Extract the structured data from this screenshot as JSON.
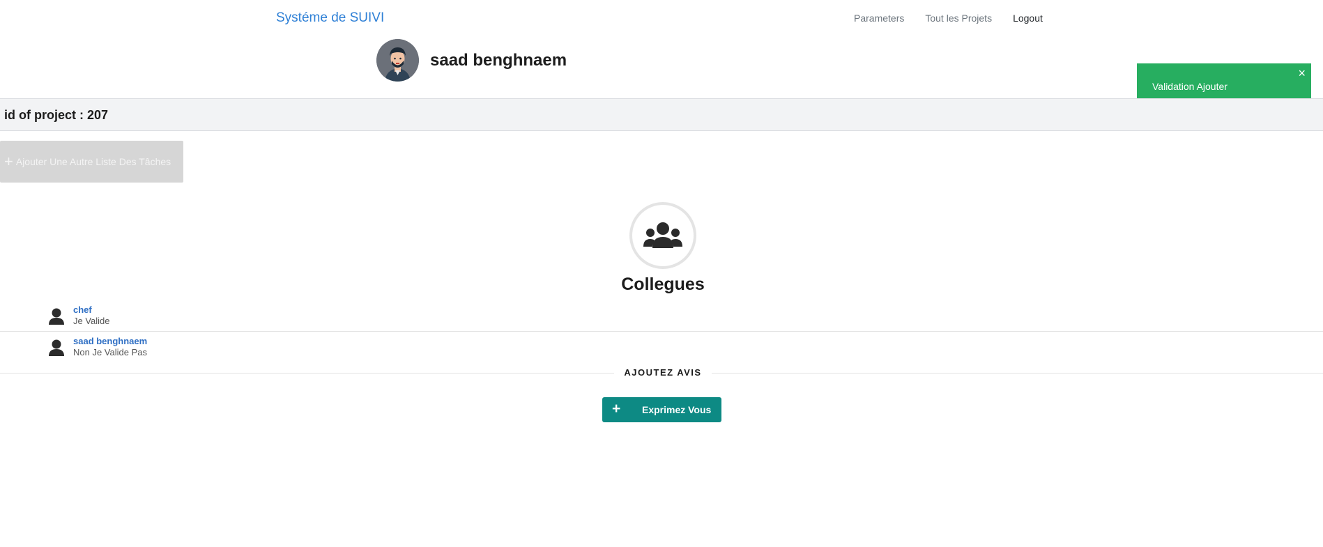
{
  "navbar": {
    "brand": "Systéme de SUIVI",
    "links": [
      "Parameters",
      "Tout les Projets",
      "Logout"
    ]
  },
  "profile": {
    "name": "saad benghnaem",
    "avatar_icon": "user-avatar-illustration"
  },
  "toast": {
    "message": "Validation Ajouter",
    "close": "×",
    "color": "#27ae60"
  },
  "project": {
    "label": "id of project : 207"
  },
  "add_list_button": {
    "icon": "plus-icon",
    "label": "Ajouter Une Autre Liste Des Tâches"
  },
  "team": {
    "icon": "users-group-icon",
    "title": "Collegues",
    "members": [
      {
        "name": "chef",
        "status": "Je Valide"
      },
      {
        "name": "saad benghnaem",
        "status": "Non Je Valide Pas"
      }
    ]
  },
  "feedback": {
    "section_label": "AJOUTEZ AVIS",
    "button_label": "Exprimez Vous",
    "button_icon": "plus-icon",
    "button_color": "#0d8a84"
  }
}
